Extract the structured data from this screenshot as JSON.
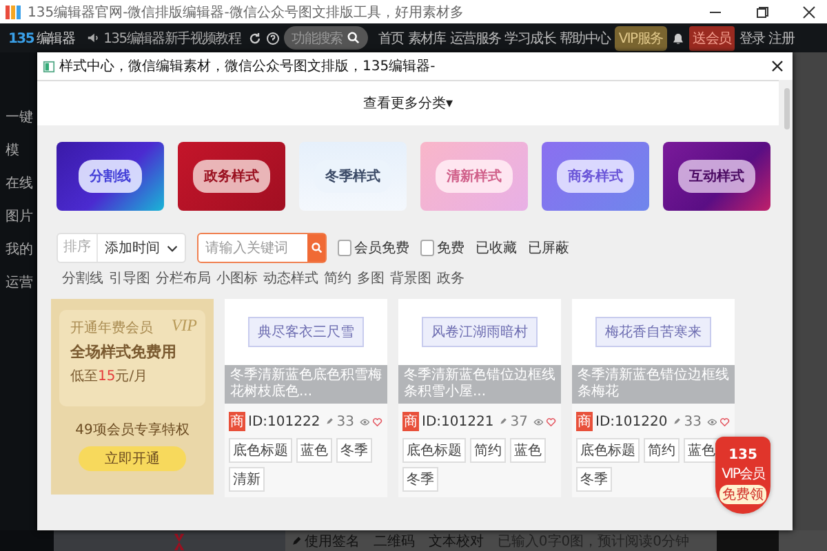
{
  "window": {
    "title": "135编辑器官网-微信排版编辑器-微信公众号图文排版工具，好用素材多"
  },
  "nav": {
    "logo": "编辑器",
    "logo_mark": "135",
    "tutorial": "135编辑器新手视频教程",
    "search_placeholder": "功能搜索",
    "items": [
      "首页",
      "素材库",
      "运营服务",
      "学习成长",
      "帮助中心"
    ],
    "vip": "VIP服务",
    "gift": "送会员",
    "login": "登录",
    "register": "注册"
  },
  "sidebar": {
    "items": [
      {
        "label": "一键",
        "selected": false
      },
      {
        "label": "模",
        "selected": false
      },
      {
        "label": "在线",
        "selected": false
      },
      {
        "label": "图片",
        "selected": false
      },
      {
        "label": "我的",
        "selected": false
      },
      {
        "label": "运营",
        "selected": false
      }
    ]
  },
  "editor_bar": {
    "signature": "使用签名",
    "qrcode": "二维码",
    "proofread": "文本校对",
    "stats": "已输入0字0图，预计阅读0分钟"
  },
  "modal": {
    "title": "样式中心，微信编辑素材，微信公众号图文排版，135编辑器-",
    "more": "查看更多分类▾",
    "categories": [
      "分割线",
      "政务样式",
      "冬季样式",
      "清新样式",
      "商务样式",
      "互动样式"
    ],
    "sort_label": "排序",
    "sort_value": "添加时间",
    "search_placeholder": "请输入关键词",
    "filters": [
      {
        "kind": "checkbox",
        "label": "会员免费",
        "checked": false
      },
      {
        "kind": "checkbox",
        "label": "免费",
        "checked": false
      },
      {
        "kind": "link",
        "label": "已收藏"
      },
      {
        "kind": "link",
        "label": "已屏蔽"
      }
    ],
    "quick_tags": [
      "分割线",
      "引导图",
      "分栏布局",
      "小图标",
      "动态样式",
      "简约",
      "多图",
      "背景图",
      "政务"
    ],
    "vip_card": {
      "heading": "开通年费会员",
      "mark": "VIP",
      "slogan": "全场样式免费用",
      "price_before": "低至",
      "price": "15",
      "price_after": "元/月",
      "perks": "49项会员专享特权",
      "button": "立即开通"
    },
    "styles": [
      {
        "preview": "典尽客衣三尺雪",
        "caption": "冬季清新蓝色底色积雪梅花树枝底色...",
        "badge": "商",
        "id": "ID:101222",
        "uses": "33",
        "favorite": false,
        "tags": [
          "底色标题",
          "蓝色",
          "冬季",
          "清新"
        ]
      },
      {
        "preview": "风卷江湖雨暗村",
        "caption": "冬季清新蓝色错位边框线条积雪小屋...",
        "badge": "商",
        "id": "ID:101221",
        "uses": "37",
        "favorite": false,
        "tags": [
          "底色标题",
          "简约",
          "蓝色",
          "冬季"
        ]
      },
      {
        "preview": "梅花香自苦寒来",
        "caption": "冬季清新蓝色错位边框线条梅花",
        "badge": "商",
        "id": "ID:101220",
        "uses": "33",
        "favorite": false,
        "tags": [
          "底色标题",
          "简约",
          "蓝色",
          "冬季"
        ]
      }
    ],
    "promo": {
      "number": "135",
      "label": "VIP会员",
      "button": "免费领"
    }
  }
}
